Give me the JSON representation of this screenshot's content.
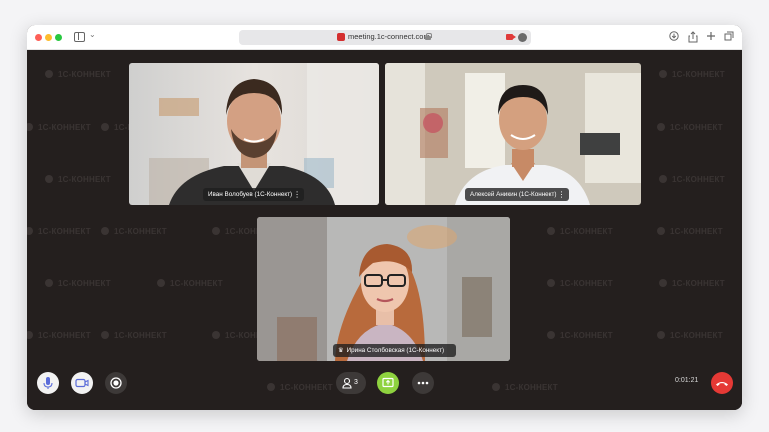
{
  "browser": {
    "url": "meeting.1c-connect.com"
  },
  "watermark": {
    "text": "1С-КОННЕКТ"
  },
  "participants": [
    {
      "name": "Иван Волобуев (1С-Коннект)"
    },
    {
      "name": "Алексей Аникин (1С-Коннект)"
    },
    {
      "name": "Ирина Столбовская (1С-Коннект)"
    }
  ],
  "controls": {
    "participants_count": "3",
    "timer": "0:01:21"
  },
  "colors": {
    "background": "#241f1e",
    "screen_share": "#8ed23f",
    "hangup": "#e53935"
  }
}
